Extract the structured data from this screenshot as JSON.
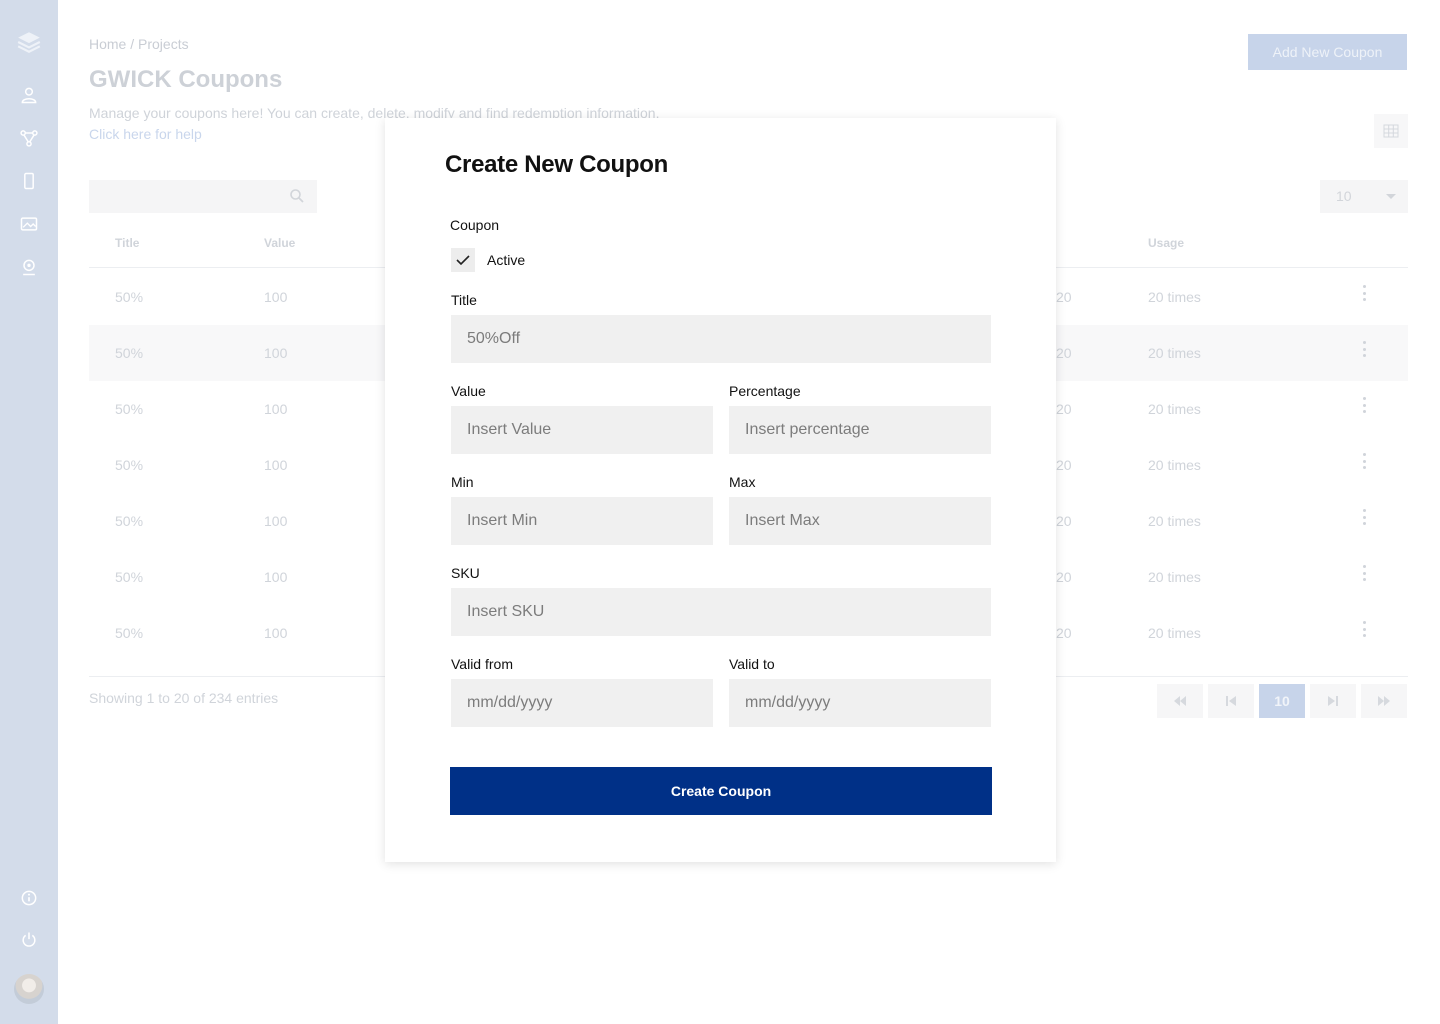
{
  "sidebar": {
    "icons": [
      "layers-logo-icon",
      "user-icon",
      "network-icon",
      "mobile-icon",
      "gallery-icon",
      "support-icon"
    ],
    "bottom_icons": [
      "info-icon",
      "power-icon"
    ]
  },
  "page": {
    "breadcrumb": "Home / Projects",
    "title": "GWICK Coupons",
    "description": "Manage your coupons here! You can create, delete, modify and find redemption information.",
    "help_link": "Click here for help",
    "add_button": "Add New Coupon",
    "per_page": "10"
  },
  "table": {
    "headers": [
      "Title",
      "Value",
      "Usage"
    ],
    "rows": [
      {
        "title": "50%",
        "value": "100",
        "date": "20",
        "usage": "20 times"
      },
      {
        "title": "50%",
        "value": "100",
        "date": "20",
        "usage": "20 times"
      },
      {
        "title": "50%",
        "value": "100",
        "date": "20",
        "usage": "20 times"
      },
      {
        "title": "50%",
        "value": "100",
        "date": "20",
        "usage": "20 times"
      },
      {
        "title": "50%",
        "value": "100",
        "date": "20",
        "usage": "20 times"
      },
      {
        "title": "50%",
        "value": "100",
        "date": "20",
        "usage": "20 times"
      },
      {
        "title": "50%",
        "value": "100",
        "date": "20",
        "usage": "20 times"
      }
    ],
    "entries": "Showing 1 to 20 of 234 entries",
    "current_page": "10"
  },
  "modal": {
    "title": "Create New Coupon",
    "coupon_label": "Coupon",
    "active_label": "Active",
    "active_checked": true,
    "title_label": "Title",
    "title_value": "50%Off",
    "value_label": "Value",
    "value_placeholder": "Insert Value",
    "percentage_label": "Percentage",
    "percentage_placeholder": "Insert percentage",
    "min_label": "Min",
    "min_placeholder": "Insert Min",
    "max_label": "Max",
    "max_placeholder": "Insert Max",
    "sku_label": "SKU",
    "sku_placeholder": "Insert SKU",
    "valid_from_label": "Valid from",
    "valid_from_placeholder": "mm/dd/yyyy",
    "valid_to_label": "Valid to",
    "valid_to_placeholder": "mm/dd/yyyy",
    "submit_label": "Create Coupon"
  },
  "colors": {
    "primary": "#003087",
    "sidebar_bg": "#d3dcea",
    "field_bg": "#f0f0f0"
  }
}
